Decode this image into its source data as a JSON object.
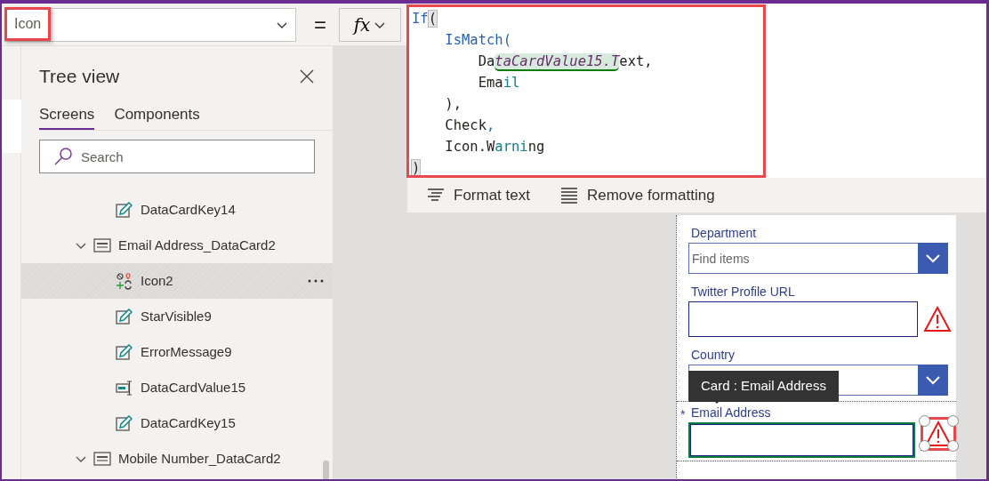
{
  "property_selector": {
    "value": "Icon"
  },
  "equals": "=",
  "formula_button": "fx",
  "formula": {
    "lines": [
      {
        "segments": [
          {
            "text": "If",
            "kind": "keyword"
          },
          {
            "text": "(",
            "kind": "bracket"
          }
        ]
      },
      {
        "segments": [
          {
            "text": "    IsMatch(",
            "kind": "keyword"
          }
        ]
      },
      {
        "segments": [
          {
            "text": "        Da",
            "kind": "plain"
          },
          {
            "text": "taCardValue15.T",
            "kind": "highlight"
          },
          {
            "text": "ext,",
            "kind": "plain"
          }
        ]
      },
      {
        "segments": [
          {
            "text": "        Ema",
            "kind": "plain"
          },
          {
            "text": "il",
            "kind": "teal"
          }
        ]
      },
      {
        "segments": [
          {
            "text": "    ),",
            "kind": "plain"
          }
        ]
      },
      {
        "segments": [
          {
            "text": "    Check",
            "kind": "plain"
          },
          {
            "text": ",",
            "kind": "teal"
          }
        ]
      },
      {
        "segments": [
          {
            "text": "    Icon.W",
            "kind": "plain"
          },
          {
            "text": "arni",
            "kind": "teal"
          },
          {
            "text": "ng",
            "kind": "plain"
          }
        ]
      },
      {
        "segments": [
          {
            "text": ")",
            "kind": "bracket"
          }
        ]
      }
    ]
  },
  "formula_toolbar": [
    {
      "label": "Format text",
      "kind": "format"
    },
    {
      "label": "Remove formatting",
      "kind": "remove"
    }
  ],
  "tree_view": {
    "title": "Tree view",
    "tabs": [
      {
        "label": "Screens",
        "selected": true
      },
      {
        "label": "Components",
        "selected": false
      }
    ],
    "search": {
      "placeholder": "Search"
    },
    "items": [
      {
        "kind": "continued",
        "children": [
          {
            "label": "DataCardKey14",
            "kind": "edit",
            "selected": false
          }
        ]
      },
      {
        "label": "Email Address_DataCard2",
        "kind": "card",
        "expanded": true,
        "selected": false,
        "children": [
          {
            "label": "Icon2",
            "kind": "icons",
            "selected": true
          },
          {
            "label": "StarVisible9",
            "kind": "edit",
            "selected": false
          },
          {
            "label": "ErrorMessage9",
            "kind": "edit",
            "selected": false
          },
          {
            "label": "DataCardValue15",
            "kind": "input",
            "selected": false
          },
          {
            "label": "DataCardKey15",
            "kind": "edit",
            "selected": false
          }
        ]
      },
      {
        "label": "Mobile Number_DataCard2",
        "kind": "card",
        "expanded": true,
        "selected": false
      }
    ]
  },
  "form": {
    "tooltip": "Card : Email Address",
    "fields": [
      {
        "label": "Department",
        "kind": "dropdown",
        "placeholder": "Find items",
        "warning": false,
        "selected": false
      },
      {
        "label": "Twitter Profile URL",
        "kind": "text",
        "warning": true,
        "selected": false
      },
      {
        "label": "Country",
        "kind": "dropdown",
        "warning": false,
        "selected": false
      },
      {
        "label": "Email Address",
        "kind": "text",
        "required_mark": "*",
        "warning": true,
        "selected": true
      }
    ]
  }
}
